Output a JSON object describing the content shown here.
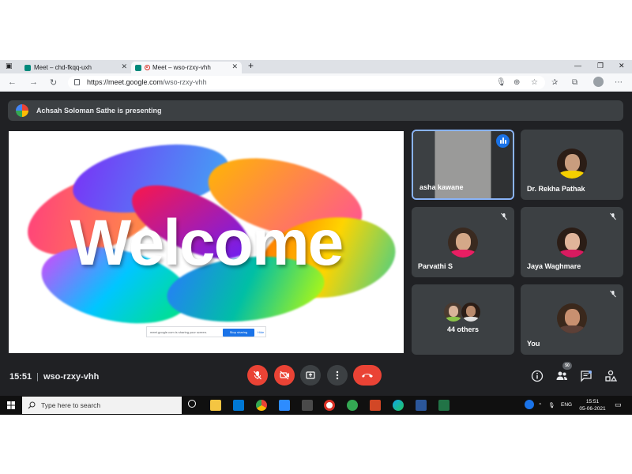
{
  "browser": {
    "tabs": [
      {
        "label": "Meet – chd-fkqq-uxh",
        "active": false
      },
      {
        "label": "Meet – wso-rzxy-vhh",
        "active": true,
        "recording": true
      }
    ],
    "url_host": "https://meet.google.com",
    "url_path": "/wso-rzxy-vhh"
  },
  "meet": {
    "presenting_banner": "Achsah Soloman Sathe is presenting",
    "slide": {
      "welcome_text": "Welcome",
      "share_bar": {
        "message": "meet.google.com is sharing your screen.",
        "stop_label": "Stop sharing",
        "hide_label": "Hide"
      }
    },
    "participants": [
      {
        "name": "asha kawane",
        "speaking": true,
        "muted": false
      },
      {
        "name": "Dr. Rekha Pathak",
        "speaking": false,
        "muted": false
      },
      {
        "name": "Parvathi S",
        "speaking": false,
        "muted": true
      },
      {
        "name": "Jaya Waghmare",
        "speaking": false,
        "muted": true
      },
      {
        "name": "44 others",
        "speaking": false,
        "muted": false
      },
      {
        "name": "You",
        "speaking": false,
        "muted": true
      }
    ],
    "time": "15:51",
    "meeting_code": "wso-rzxy-vhh",
    "participant_count": "50"
  },
  "taskbar": {
    "search_placeholder": "Type here to search",
    "language": "ENG",
    "time": "15:51",
    "date": "05-06-2021"
  },
  "colors": {
    "meet_bg": "#202124",
    "tile_bg": "#3c4043",
    "end_call": "#ea4335",
    "speaking_border": "#8ab4f8",
    "accent_blue": "#1a73e8"
  }
}
